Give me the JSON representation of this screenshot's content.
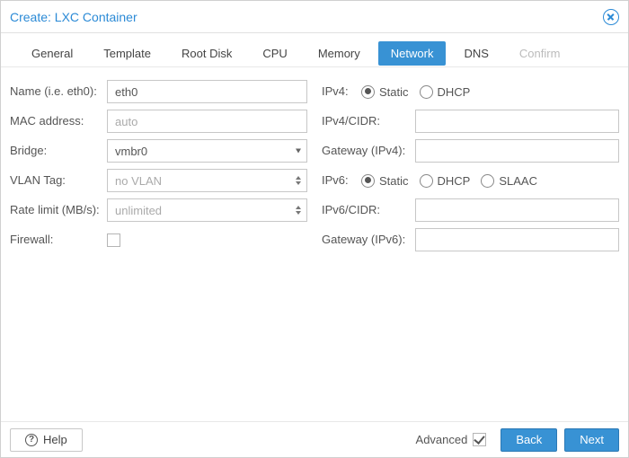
{
  "title": "Create: LXC Container",
  "tabs": [
    "General",
    "Template",
    "Root Disk",
    "CPU",
    "Memory",
    "Network",
    "DNS",
    "Confirm"
  ],
  "active_tab": "Network",
  "disabled_tab": "Confirm",
  "left": {
    "name_label": "Name (i.e. eth0):",
    "name_value": "eth0",
    "mac_label": "MAC address:",
    "mac_placeholder": "auto",
    "bridge_label": "Bridge:",
    "bridge_value": "vmbr0",
    "vlan_label": "VLAN Tag:",
    "vlan_placeholder": "no VLAN",
    "rate_label": "Rate limit (MB/s):",
    "rate_placeholder": "unlimited",
    "firewall_label": "Firewall:"
  },
  "right": {
    "ipv4_label": "IPv4:",
    "ipv4_static": "Static",
    "ipv4_dhcp": "DHCP",
    "ipv4_cidr_label": "IPv4/CIDR:",
    "gw4_label": "Gateway (IPv4):",
    "ipv6_label": "IPv6:",
    "ipv6_static": "Static",
    "ipv6_dhcp": "DHCP",
    "ipv6_slaac": "SLAAC",
    "ipv6_cidr_label": "IPv6/CIDR:",
    "gw6_label": "Gateway (IPv6):"
  },
  "footer": {
    "help": "Help",
    "advanced": "Advanced",
    "back": "Back",
    "next": "Next"
  }
}
